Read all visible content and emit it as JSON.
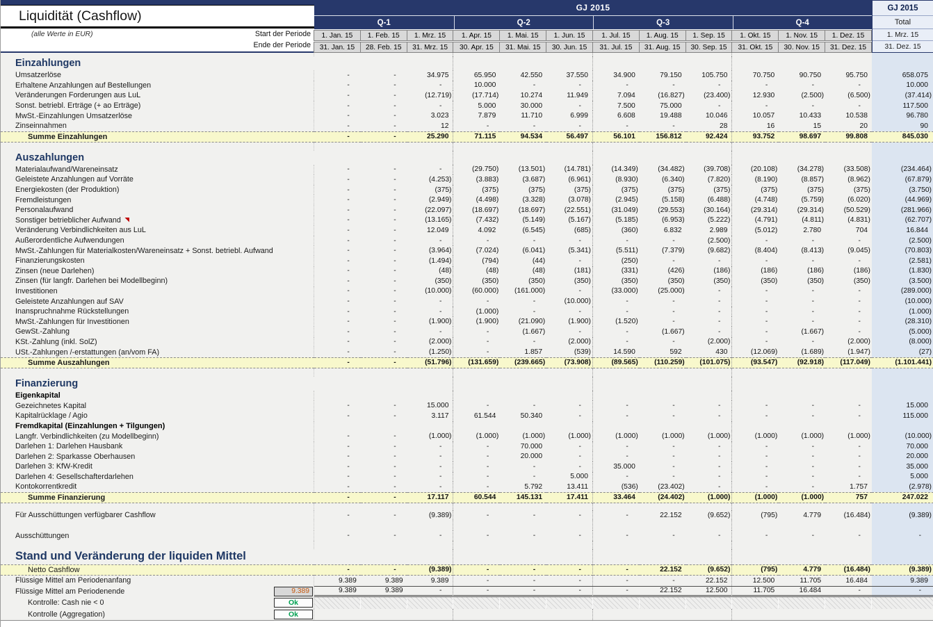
{
  "title": "Liquidität (Cashflow)",
  "subtitle": "(alle Werte in EUR)",
  "colors": {
    "header_navy": "#27386b",
    "sum_row_yellow": "#f8f8cc",
    "total_column_blue": "#dce5f1",
    "ok_green": "#00a050",
    "check_orange": "#c55a11",
    "comment_marker_red": "#c00000"
  },
  "header": {
    "fiscal_year_label": "GJ 2015",
    "quarters": [
      "Q-1",
      "Q-2",
      "Q-3",
      "Q-4"
    ],
    "period_start_label": "Start der Periode",
    "period_end_label": "Ende der Periode",
    "period_starts": [
      "1. Jan. 15",
      "1. Feb. 15",
      "1. Mrz. 15",
      "1. Apr. 15",
      "1. Mai. 15",
      "1. Jun. 15",
      "1. Jul. 15",
      "1. Aug. 15",
      "1. Sep. 15",
      "1. Okt. 15",
      "1. Nov. 15",
      "1. Dez. 15"
    ],
    "period_ends": [
      "31. Jan. 15",
      "28. Feb. 15",
      "31. Mrz. 15",
      "30. Apr. 15",
      "31. Mai. 15",
      "30. Jun. 15",
      "31. Jul. 15",
      "31. Aug. 15",
      "30. Sep. 15",
      "31. Okt. 15",
      "30. Nov. 15",
      "31. Dez. 15"
    ],
    "total_group_label": "GJ 2015",
    "total_label": "Total",
    "total_period_start": "1. Mrz. 15",
    "total_period_end": "31. Dez. 15"
  },
  "sections": [
    {
      "t": "gap",
      "h": 5
    },
    {
      "t": "head",
      "size": "lg",
      "label": "Einzahlungen"
    },
    {
      "t": "row",
      "label": "Umsatzerlöse",
      "v": [
        "-",
        "-",
        "34.975",
        "65.950",
        "42.550",
        "37.550",
        "34.900",
        "79.150",
        "105.750",
        "70.750",
        "90.750",
        "95.750"
      ],
      "total": "658.075"
    },
    {
      "t": "row",
      "label": "Erhaltene Anzahlungen auf Bestellungen",
      "v": [
        "-",
        "-",
        "-",
        "10.000",
        "-",
        "-",
        "-",
        "-",
        "-",
        "-",
        "-",
        "-"
      ],
      "total": "10.000"
    },
    {
      "t": "row",
      "label": "Veränderungen Forderungen aus LuL",
      "v": [
        "-",
        "-",
        "(12.719)",
        "(17.714)",
        "10.274",
        "11.949",
        "7.094",
        "(16.827)",
        "(23.400)",
        "12.930",
        "(2.500)",
        "(6.500)"
      ],
      "total": "(37.414)"
    },
    {
      "t": "row",
      "label": "Sonst. betriebl. Erträge (+ ao Erträge)",
      "v": [
        "-",
        "-",
        "-",
        "5.000",
        "30.000",
        "-",
        "7.500",
        "75.000",
        "-",
        "-",
        "-",
        "-"
      ],
      "total": "117.500"
    },
    {
      "t": "row",
      "label": "MwSt.-Einzahlungen Umsatzerlöse",
      "v": [
        "-",
        "-",
        "3.023",
        "7.879",
        "11.710",
        "6.999",
        "6.608",
        "19.488",
        "10.046",
        "10.057",
        "10.433",
        "10.538"
      ],
      "total": "96.780"
    },
    {
      "t": "row",
      "label": "Zinseinnahmen",
      "v": [
        "-",
        "-",
        "12",
        "-",
        "-",
        "-",
        "-",
        "-",
        "28",
        "16",
        "15",
        "20"
      ],
      "total": "90"
    },
    {
      "t": "sum",
      "label": "Summe Einzahlungen",
      "v": [
        "-",
        "-",
        "25.290",
        "71.115",
        "94.534",
        "56.497",
        "56.101",
        "156.812",
        "92.424",
        "93.752",
        "98.697",
        "99.808"
      ],
      "total": "845.030"
    },
    {
      "t": "gap",
      "h": 12
    },
    {
      "t": "head",
      "size": "lg",
      "label": "Auszahlungen"
    },
    {
      "t": "row",
      "label": "Materialaufwand/Wareneinsatz",
      "v": [
        "-",
        "-",
        "-",
        "(29.750)",
        "(13.501)",
        "(14.781)",
        "(14.349)",
        "(34.482)",
        "(39.708)",
        "(20.108)",
        "(34.278)",
        "(33.508)"
      ],
      "total": "(234.464)"
    },
    {
      "t": "row",
      "label": "Geleistete Anzahlungen auf Vorräte",
      "v": [
        "-",
        "-",
        "(4.253)",
        "(3.883)",
        "(3.687)",
        "(6.961)",
        "(8.930)",
        "(6.340)",
        "(7.820)",
        "(8.190)",
        "(8.857)",
        "(8.962)"
      ],
      "total": "(67.879)"
    },
    {
      "t": "row",
      "label": "Energiekosten (der Produktion)",
      "v": [
        "-",
        "-",
        "(375)",
        "(375)",
        "(375)",
        "(375)",
        "(375)",
        "(375)",
        "(375)",
        "(375)",
        "(375)",
        "(375)"
      ],
      "total": "(3.750)"
    },
    {
      "t": "row",
      "label": "Fremdleistungen",
      "v": [
        "-",
        "-",
        "(2.949)",
        "(4.498)",
        "(3.328)",
        "(3.078)",
        "(2.945)",
        "(5.158)",
        "(6.488)",
        "(4.748)",
        "(5.759)",
        "(6.020)"
      ],
      "total": "(44.969)"
    },
    {
      "t": "row",
      "label": "Personalaufwand",
      "v": [
        "-",
        "-",
        "(22.097)",
        "(18.697)",
        "(18.697)",
        "(22.551)",
        "(31.049)",
        "(29.553)",
        "(30.164)",
        "(29.314)",
        "(29.314)",
        "(50.529)"
      ],
      "total": "(281.966)"
    },
    {
      "t": "row",
      "label": "Sonstiger betrieblicher Aufwand",
      "marker": true,
      "v": [
        "-",
        "-",
        "(13.165)",
        "(7.432)",
        "(5.149)",
        "(5.167)",
        "(5.185)",
        "(6.953)",
        "(5.222)",
        "(4.791)",
        "(4.811)",
        "(4.831)"
      ],
      "total": "(62.707)"
    },
    {
      "t": "row",
      "label": "Veränderung Verbindlichkeiten aus LuL",
      "v": [
        "-",
        "-",
        "12.049",
        "4.092",
        "(6.545)",
        "(685)",
        "(360)",
        "6.832",
        "2.989",
        "(5.012)",
        "2.780",
        "704"
      ],
      "total": "16.844"
    },
    {
      "t": "row",
      "label": "Außerordentliche Aufwendungen",
      "v": [
        "-",
        "-",
        "-",
        "-",
        "-",
        "-",
        "-",
        "-",
        "(2.500)",
        "-",
        "-",
        "-"
      ],
      "total": "(2.500)"
    },
    {
      "t": "row",
      "label": "MwSt.-Zahlungen für Materialkosten/Wareneinsatz + Sonst. betriebl. Aufwand",
      "v": [
        "-",
        "-",
        "(3.964)",
        "(7.024)",
        "(6.041)",
        "(5.341)",
        "(5.511)",
        "(7.379)",
        "(9.682)",
        "(8.404)",
        "(8.413)",
        "(9.045)"
      ],
      "total": "(70.803)"
    },
    {
      "t": "row",
      "label": "Finanzierungskosten",
      "v": [
        "-",
        "-",
        "(1.494)",
        "(794)",
        "(44)",
        "-",
        "(250)",
        "-",
        "-",
        "-",
        "-",
        "-"
      ],
      "total": "(2.581)"
    },
    {
      "t": "row",
      "label": "Zinsen (neue Darlehen)",
      "v": [
        "-",
        "-",
        "(48)",
        "(48)",
        "(48)",
        "(181)",
        "(331)",
        "(426)",
        "(186)",
        "(186)",
        "(186)",
        "(186)"
      ],
      "total": "(1.830)"
    },
    {
      "t": "row",
      "label": "Zinsen (für langfr. Darlehen bei Modellbeginn)",
      "v": [
        "-",
        "-",
        "(350)",
        "(350)",
        "(350)",
        "(350)",
        "(350)",
        "(350)",
        "(350)",
        "(350)",
        "(350)",
        "(350)"
      ],
      "total": "(3.500)"
    },
    {
      "t": "row",
      "label": "Investitionen",
      "v": [
        "-",
        "-",
        "(10.000)",
        "(60.000)",
        "(161.000)",
        "-",
        "(33.000)",
        "(25.000)",
        "-",
        "-",
        "-",
        "-"
      ],
      "total": "(289.000)"
    },
    {
      "t": "row",
      "label": "Geleistete Anzahlungen auf SAV",
      "v": [
        "-",
        "-",
        "-",
        "-",
        "-",
        "(10.000)",
        "-",
        "-",
        "-",
        "-",
        "-",
        "-"
      ],
      "total": "(10.000)"
    },
    {
      "t": "row",
      "label": "Inanspruchnahme Rückstellungen",
      "v": [
        "-",
        "-",
        "-",
        "(1.000)",
        "-",
        "-",
        "-",
        "-",
        "-",
        "-",
        "-",
        "-"
      ],
      "total": "(1.000)"
    },
    {
      "t": "row",
      "label": "MwSt.-Zahlungen für Investitionen",
      "v": [
        "-",
        "-",
        "(1.900)",
        "(1.900)",
        "(21.090)",
        "(1.900)",
        "(1.520)",
        "-",
        "-",
        "-",
        "-",
        "-"
      ],
      "total": "(28.310)"
    },
    {
      "t": "row",
      "label": "GewSt.-Zahlung",
      "v": [
        "-",
        "-",
        "-",
        "-",
        "(1.667)",
        "-",
        "-",
        "(1.667)",
        "-",
        "-",
        "(1.667)",
        "-"
      ],
      "total": "(5.000)"
    },
    {
      "t": "row",
      "label": "KSt.-Zahlung (inkl. SolZ)",
      "v": [
        "-",
        "-",
        "(2.000)",
        "-",
        "-",
        "(2.000)",
        "-",
        "-",
        "(2.000)",
        "-",
        "-",
        "(2.000)"
      ],
      "total": "(8.000)"
    },
    {
      "t": "row",
      "label": "USt.-Zahlungen /-erstattungen (an/vom FA)",
      "v": [
        "-",
        "-",
        "(1.250)",
        "-",
        "1.857",
        "(539)",
        "14.590",
        "592",
        "430",
        "(12.069)",
        "(1.689)",
        "(1.947)"
      ],
      "total": "(27)"
    },
    {
      "t": "sum",
      "label": "Summe Auszahlungen",
      "v": [
        "-",
        "-",
        "(51.796)",
        "(131.659)",
        "(239.665)",
        "(73.908)",
        "(89.565)",
        "(110.259)",
        "(101.075)",
        "(93.547)",
        "(92.918)",
        "(117.049)"
      ],
      "total": "(1.101.441)"
    },
    {
      "t": "gap",
      "h": 12
    },
    {
      "t": "head",
      "size": "lg",
      "label": "Finanzierung"
    },
    {
      "t": "bold",
      "label": "Eigenkapital"
    },
    {
      "t": "row",
      "label": "Gezeichnetes Kapital",
      "v": [
        "-",
        "-",
        "15.000",
        "-",
        "-",
        "-",
        "-",
        "-",
        "-",
        "-",
        "-",
        "-"
      ],
      "total": "15.000"
    },
    {
      "t": "row",
      "label": "Kapitalrücklage / Agio",
      "v": [
        "-",
        "-",
        "3.117",
        "61.544",
        "50.340",
        "-",
        "-",
        "-",
        "-",
        "-",
        "-",
        "-"
      ],
      "total": "115.000"
    },
    {
      "t": "bold",
      "label": "Fremdkapital (Einzahlungen + Tilgungen)"
    },
    {
      "t": "row",
      "label": "Langfr. Verbindlichkeiten (zu Modellbeginn)",
      "v": [
        "-",
        "-",
        "(1.000)",
        "(1.000)",
        "(1.000)",
        "(1.000)",
        "(1.000)",
        "(1.000)",
        "(1.000)",
        "(1.000)",
        "(1.000)",
        "(1.000)"
      ],
      "total": "(10.000)"
    },
    {
      "t": "row",
      "label": "Darlehen 1: Darlehen Hausbank",
      "v": [
        "-",
        "-",
        "-",
        "-",
        "70.000",
        "-",
        "-",
        "-",
        "-",
        "-",
        "-",
        "-"
      ],
      "total": "70.000"
    },
    {
      "t": "row",
      "label": "Darlehen 2: Sparkasse Oberhausen",
      "v": [
        "-",
        "-",
        "-",
        "-",
        "20.000",
        "-",
        "-",
        "-",
        "-",
        "-",
        "-",
        "-"
      ],
      "total": "20.000"
    },
    {
      "t": "row",
      "label": "Darlehen 3: KfW-Kredit",
      "v": [
        "-",
        "-",
        "-",
        "-",
        "-",
        "-",
        "35.000",
        "-",
        "-",
        "-",
        "-",
        "-"
      ],
      "total": "35.000"
    },
    {
      "t": "row",
      "label": "Darlehen 4: Gesellschafterdarlehen",
      "v": [
        "-",
        "-",
        "-",
        "-",
        "-",
        "5.000",
        "-",
        "-",
        "-",
        "-",
        "-",
        "-"
      ],
      "total": "5.000"
    },
    {
      "t": "row",
      "label": "Kontokorrentkredit",
      "v": [
        "-",
        "-",
        "-",
        "-",
        "5.792",
        "13.411",
        "(536)",
        "(23.402)",
        "-",
        "-",
        "-",
        "1.757"
      ],
      "total": "(2.978)"
    },
    {
      "t": "sum",
      "label": "Summe Finanzierung",
      "v": [
        "-",
        "-",
        "17.117",
        "60.544",
        "145.131",
        "17.411",
        "33.464",
        "(24.402)",
        "(1.000)",
        "(1.000)",
        "(1.000)",
        "757"
      ],
      "total": "247.022"
    },
    {
      "t": "gap",
      "h": 10
    },
    {
      "t": "row",
      "label": "Für Ausschüttungen verfügbarer Cashflow",
      "v": [
        "-",
        "-",
        "(9.389)",
        "-",
        "-",
        "-",
        "-",
        "22.152",
        "(9.652)",
        "(795)",
        "4.779",
        "(16.484)"
      ],
      "total": "(9.389)"
    },
    {
      "t": "gap",
      "h": 15
    },
    {
      "t": "row",
      "label": "Ausschüttungen",
      "v": [
        "-",
        "-",
        "-",
        "-",
        "-",
        "-",
        "-",
        "-",
        "-",
        "-",
        "-",
        "-"
      ],
      "total": "-"
    },
    {
      "t": "gap",
      "h": 12
    },
    {
      "t": "head",
      "size": "xl",
      "label": "Stand und Veränderung der liquiden Mittel"
    },
    {
      "t": "sum",
      "plainLabel": true,
      "label": "Netto Cashflow",
      "v": [
        "-",
        "-",
        "(9.389)",
        "-",
        "-",
        "-",
        "-",
        "22.152",
        "(9.652)",
        "(795)",
        "4.779",
        "(16.484)"
      ],
      "total": "(9.389)"
    },
    {
      "t": "row",
      "label": "Flüssige Mittel am Periodenanfang",
      "v": [
        "9.389",
        "9.389",
        "9.389",
        "-",
        "-",
        "-",
        "-",
        "-",
        "22.152",
        "12.500",
        "11.705",
        "16.484"
      ],
      "total": "9.389"
    },
    {
      "t": "ende",
      "label": "Flüssige Mittel am Periodenende",
      "check": "9.389",
      "v": [
        "9.389",
        "9.389",
        "-",
        "-",
        "-",
        "-",
        "-",
        "22.152",
        "12.500",
        "11.705",
        "16.484",
        "-"
      ],
      "total": "-"
    },
    {
      "t": "ctrl",
      "label": "Kontrolle: Cash nie < 0",
      "ok": "Ok",
      "hatch": true
    },
    {
      "t": "ctrl",
      "label": "Kontrolle (Aggregation)",
      "ok": "Ok",
      "hatch": false
    }
  ]
}
